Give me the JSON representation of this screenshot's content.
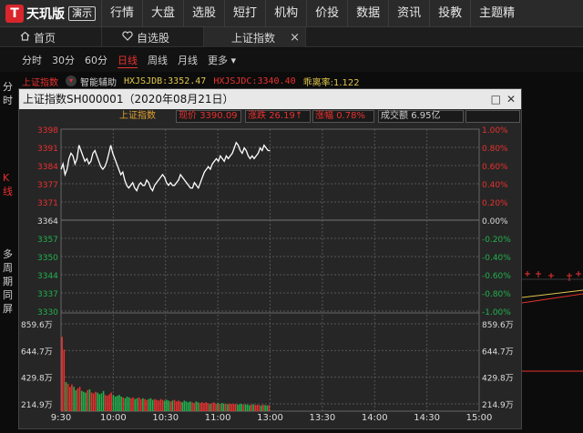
{
  "header": {
    "logo_mark": "T",
    "logo_text": "天玑版",
    "logo_badge": "演示",
    "nav": [
      "行情",
      "大盘",
      "选股",
      "短打",
      "机构",
      "价投",
      "数据",
      "资讯",
      "投教",
      "主题精"
    ]
  },
  "tabs": [
    {
      "label": "首页",
      "icon": "home-icon"
    },
    {
      "label": "自选股",
      "icon": "heart-icon"
    },
    {
      "label": "上证指数",
      "icon": ""
    }
  ],
  "tab_close": "×",
  "periods": [
    "分时",
    "30分",
    "60分",
    "日线",
    "周线",
    "月线",
    "更多 ▾"
  ],
  "active_period": "日线",
  "infobar": {
    "index_name": "上证指数",
    "assist": "智能辅助",
    "jdb": "HXJSJDB:3352.47",
    "jdc": "HXJSJDC:3340.40",
    "deviation": "乖离率:1.122"
  },
  "left_rail": [
    "分时",
    "K线",
    "多周期同屏"
  ],
  "popup": {
    "title": "上证指数SH000001（2020年08月21日）",
    "min_btn": "□",
    "close_btn": "✕",
    "legend_name": "上证指数",
    "price_label": "现价",
    "price": "3390.09",
    "change_label": "涨跌",
    "change": "26.19↑",
    "pct_label": "涨幅",
    "pct": "0.78%",
    "volume_label": "成交额",
    "volume": "6.95亿"
  },
  "chart_data": {
    "type": "line",
    "price_ticks": [
      "3398",
      "3391",
      "3384",
      "3377",
      "3371",
      "3364",
      "3357",
      "3350",
      "3344",
      "3337",
      "3330"
    ],
    "pct_ticks": [
      "1.00%",
      "0.80%",
      "0.60%",
      "0.40%",
      "0.20%",
      "0.00%",
      "-0.20%",
      "-0.40%",
      "-0.60%",
      "-0.80%",
      "-1.00%"
    ],
    "volume_ticks": [
      "859.6万",
      "644.7万",
      "429.8万",
      "214.9万"
    ],
    "time_ticks": [
      "9:30",
      "10:00",
      "10:30",
      "11:00",
      "13:00",
      "13:30",
      "14:00",
      "14:30",
      "15:00"
    ],
    "prev_close": 3364,
    "ylim": [
      3330,
      3398
    ],
    "price_series": [
      3383,
      3385,
      3381,
      3383,
      3387,
      3389,
      3388,
      3385,
      3387,
      3392,
      3390,
      3388,
      3386,
      3387,
      3385,
      3386,
      3389,
      3390,
      3388,
      3386,
      3384,
      3383,
      3384,
      3386,
      3389,
      3392,
      3389,
      3387,
      3385,
      3383,
      3381,
      3382,
      3379,
      3377,
      3376,
      3377,
      3378,
      3376,
      3375,
      3377,
      3378,
      3377,
      3377,
      3379,
      3378,
      3376,
      3375,
      3377,
      3378,
      3379,
      3380,
      3381,
      3380,
      3378,
      3377,
      3378,
      3377,
      3377,
      3378,
      3379,
      3381,
      3380,
      3379,
      3378,
      3377,
      3376,
      3376,
      3378,
      3377,
      3376,
      3378,
      3380,
      3382,
      3383,
      3384,
      3383,
      3385,
      3386,
      3387,
      3386,
      3388,
      3387,
      3386,
      3388,
      3387,
      3388,
      3389,
      3391,
      3393,
      3392,
      3390,
      3389,
      3391,
      3390,
      3388,
      3387,
      3388,
      3387,
      3388,
      3389,
      3391,
      3390,
      3392,
      3391,
      3390,
      3390
    ],
    "volume_series": [
      920,
      760,
      360,
      340,
      300,
      330,
      300,
      260,
      280,
      300,
      250,
      240,
      230,
      260,
      270,
      230,
      220,
      240,
      230,
      210,
      220,
      250,
      200,
      190,
      210,
      230,
      200,
      180,
      190,
      200,
      180,
      170,
      160,
      180,
      170,
      160,
      170,
      150,
      160,
      170,
      150,
      160,
      150,
      140,
      150,
      160,
      140,
      150,
      140,
      130,
      150,
      140,
      130,
      140,
      130,
      120,
      130,
      140,
      120,
      130,
      120,
      110,
      130,
      120,
      110,
      120,
      110,
      100,
      120,
      110,
      100,
      110,
      100,
      110,
      100,
      90,
      100,
      110,
      90,
      100,
      90,
      100,
      95,
      90,
      85,
      95,
      90,
      85,
      90,
      80,
      85,
      90,
      80,
      85,
      80,
      75,
      80,
      85,
      75,
      80,
      75,
      70,
      80,
      75,
      70,
      75
    ]
  },
  "colors": {
    "up": "#e8312f",
    "down": "#22b14c",
    "price_line": "#ffffff",
    "yellow": "#e0c64a",
    "grid": "#555555"
  }
}
